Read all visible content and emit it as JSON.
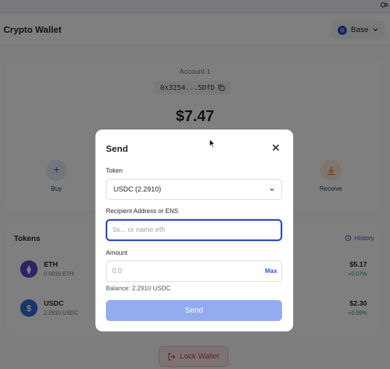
{
  "header": {
    "title": "Crypto Wallet",
    "network": "Base"
  },
  "account": {
    "name": "Account 1",
    "address": "0x3254...5DfD",
    "balance": "$7.47"
  },
  "actions": {
    "buy": "Buy",
    "receive": "Receive"
  },
  "tokens": {
    "title": "Tokens",
    "history_label": "History",
    "items": [
      {
        "symbol": "ETH",
        "amount": "0.0016 ETH",
        "value": "$5.17",
        "change": "+0.07%",
        "icon": "ethereum-icon",
        "icon_glyph": "⧫",
        "color": "#5b49c9"
      },
      {
        "symbol": "USDC",
        "amount": "2.2910 USDC",
        "value": "$2.30",
        "change": "+0.59%",
        "icon": "usdc-icon",
        "icon_glyph": "$",
        "color": "#2f6fd8"
      }
    ]
  },
  "lock_label": "Lock Wallet",
  "modal": {
    "title": "Send",
    "token_label": "Token",
    "token_selected": "USDC (2.2910)",
    "recipient_label": "Recipient Address or ENS",
    "recipient_placeholder": "0x... or name.eth",
    "recipient_value": "",
    "amount_label": "Amount",
    "amount_placeholder": "0.0",
    "amount_value": "",
    "max_label": "Max",
    "balance_hint": "Balance: 2.2910 USDC",
    "send_label": "Send"
  },
  "colors": {
    "accent": "#2f5fd0",
    "send_disabled": "#93abf0",
    "positive": "#16a34a",
    "danger": "#d23b3b"
  }
}
